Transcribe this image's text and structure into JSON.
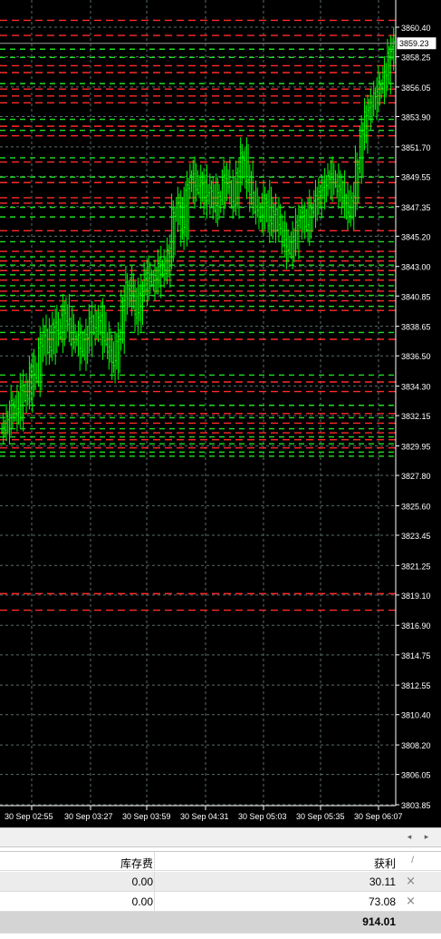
{
  "chart": {
    "background": "#000000",
    "bar_color": "#00ff00",
    "grid_color": "#5a6b6b",
    "last_price": "3859.23",
    "price_labels": [
      "3860.40",
      "3858.25",
      "3856.05",
      "3853.90",
      "3851.70",
      "3849.55",
      "3847.35",
      "3845.20",
      "3843.00",
      "3840.85",
      "3838.65",
      "3836.50",
      "3834.30",
      "3832.15",
      "3829.95",
      "3827.80",
      "3825.60",
      "3823.45",
      "3821.25",
      "3819.10",
      "3816.90",
      "3814.75",
      "3812.55",
      "3810.40",
      "3808.20",
      "3806.05",
      "3803.85"
    ],
    "time_labels": [
      "30 Sep 02:55",
      "30 Sep 03:27",
      "30 Sep 03:59",
      "30 Sep 04:31",
      "30 Sep 05:03",
      "30 Sep 05:35",
      "30 Sep 06:07"
    ],
    "price_min": 3803.85,
    "price_max": 3860.4,
    "red_levels": [
      3860.9,
      3859.8,
      3857.6,
      3857.1,
      3855.9,
      3855.4,
      3854.9,
      3853.2,
      3852.5,
      3850.6,
      3849.1,
      3848.0,
      3847.6,
      3845.6,
      3844.1,
      3843.4,
      3842.7,
      3842.0,
      3841.2,
      3840.5,
      3839.8,
      3837.7,
      3834.6,
      3833.9,
      3832.3,
      3831.6,
      3830.9,
      3830.4,
      3829.8,
      3819.2,
      3818.0
    ],
    "green_levels": [
      3858.8,
      3858.2,
      3856.3,
      3853.7,
      3852.9,
      3850.9,
      3849.5,
      3847.3,
      3846.6,
      3844.8,
      3843.7,
      3843.1,
      3842.4,
      3841.6,
      3840.9,
      3840.1,
      3838.2,
      3835.1,
      3832.9,
      3832.0,
      3831.2,
      3830.6,
      3830.1,
      3829.5,
      3829.2
    ],
    "bar_path": [
      3831.2,
      3832.1,
      3833.0,
      3832.4,
      3834.1,
      3833.5,
      3835.6,
      3834.9,
      3837.2,
      3838.1,
      3837.0,
      3838.8,
      3838.1,
      3839.6,
      3838.9,
      3837.6,
      3837.9,
      3836.8,
      3837.8,
      3839.1,
      3838.4,
      3839.3,
      3837.6,
      3836.9,
      3835.9,
      3837.8,
      3840.4,
      3841.6,
      3840.8,
      3839.4,
      3841.3,
      3842.4,
      3841.9,
      3842.1,
      3843.1,
      3842.6,
      3844.2,
      3846.9,
      3847.4,
      3845.6,
      3848.8,
      3849.6,
      3848.6,
      3849.0,
      3847.9,
      3848.6,
      3847.3,
      3848.1,
      3849.4,
      3848.9,
      3847.6,
      3849.8,
      3851.0,
      3849.3,
      3848.1,
      3847.2,
      3846.6,
      3847.9,
      3846.1,
      3846.9,
      3845.9,
      3844.8,
      3844.2,
      3844.9,
      3846.1,
      3846.8,
      3845.9,
      3847.2,
      3847.9,
      3848.3,
      3849.0,
      3849.6,
      3849.1,
      3848.6,
      3847.9,
      3846.8,
      3848.0,
      3850.4,
      3852.6,
      3854.1,
      3854.8,
      3855.6,
      3856.2,
      3856.9,
      3858.4,
      3859.23
    ]
  },
  "terminal": {
    "header": {
      "col_swap": "库存费",
      "col_profit": "获利",
      "sort_mark": "/"
    },
    "rows": [
      {
        "swap": "0.00",
        "profit": "30.11",
        "close_icon": "×"
      },
      {
        "swap": "0.00",
        "profit": "73.08",
        "close_icon": "×"
      }
    ],
    "total": {
      "profit": "914.01"
    }
  },
  "scroll": {
    "left_arrow": "◂",
    "right_arrow": "▸"
  }
}
